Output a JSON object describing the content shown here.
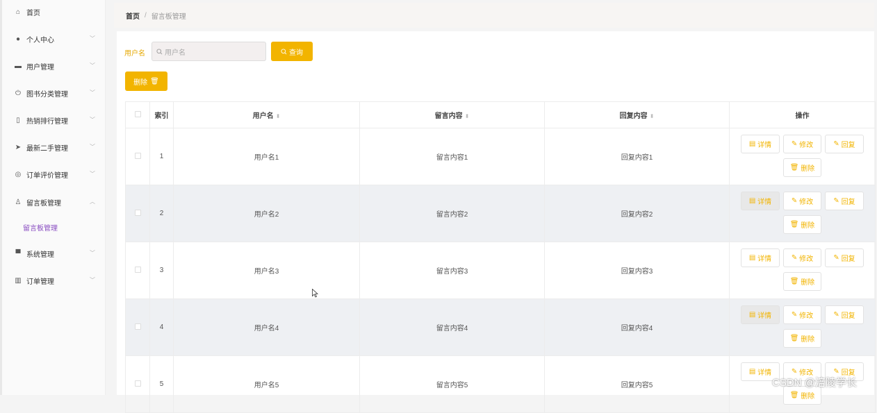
{
  "sidebar": {
    "items": [
      {
        "label": "首页",
        "icon": "home-icon",
        "glyph": "⌂"
      },
      {
        "label": "个人中心",
        "icon": "user-icon",
        "glyph": "●"
      },
      {
        "label": "用户管理",
        "icon": "briefcase-icon",
        "glyph": "▬"
      },
      {
        "label": "图书分类管理",
        "icon": "power-icon",
        "glyph": "⏻"
      },
      {
        "label": "热销排行管理",
        "icon": "bulb-icon",
        "glyph": "▯"
      },
      {
        "label": "最新二手管理",
        "icon": "send-icon",
        "glyph": "➤"
      },
      {
        "label": "订单评价管理",
        "icon": "settings-icon",
        "glyph": "◎"
      },
      {
        "label": "留言板管理",
        "icon": "person-icon",
        "glyph": "♙"
      },
      {
        "label": "系统管理",
        "icon": "monitor-icon",
        "glyph": "▀"
      },
      {
        "label": "订单管理",
        "icon": "chart-icon",
        "glyph": "▥"
      }
    ],
    "sub_item": "留言板管理"
  },
  "breadcrumb": {
    "home": "首页",
    "separator": "/",
    "current": "留言板管理"
  },
  "search": {
    "label": "用户名",
    "placeholder": "用户名",
    "query_button": "查询"
  },
  "toolbar": {
    "delete_button": "删除"
  },
  "table": {
    "columns": [
      "索引",
      "用户名",
      "留言内容",
      "回复内容",
      "操作"
    ],
    "rows": [
      {
        "index": "1",
        "username": "用户名1",
        "content": "留言内容1",
        "reply": "回复内容1"
      },
      {
        "index": "2",
        "username": "用户名2",
        "content": "留言内容2",
        "reply": "回复内容2"
      },
      {
        "index": "3",
        "username": "用户名3",
        "content": "留言内容3",
        "reply": "回复内容3"
      },
      {
        "index": "4",
        "username": "用户名4",
        "content": "留言内容4",
        "reply": "回复内容4"
      },
      {
        "index": "5",
        "username": "用户名5",
        "content": "留言内容5",
        "reply": "回复内容5"
      }
    ],
    "actions": {
      "detail": "详情",
      "edit": "修改",
      "reply": "回复",
      "delete": "删除"
    }
  },
  "watermark": "CSDN @涪陵学长",
  "colors": {
    "accent": "#f2b400",
    "sub_active": "#8a4ec2"
  }
}
